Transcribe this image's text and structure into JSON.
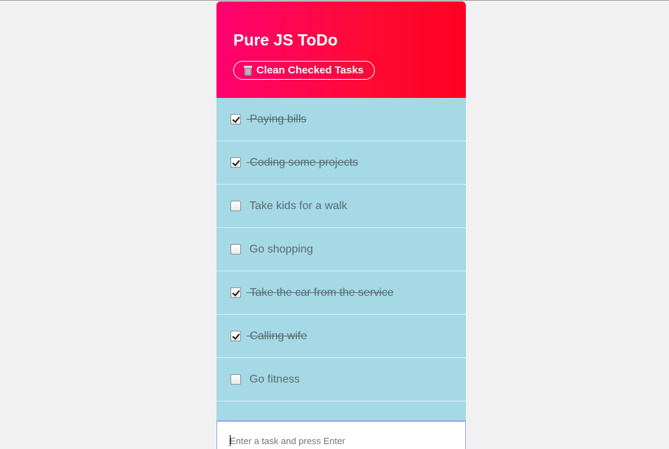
{
  "app": {
    "title": "Pure JS ToDo",
    "clean_button_label": "Clean Checked Tasks",
    "clean_button_icon": "trash-icon"
  },
  "tasks": [
    {
      "label": "Paying bills",
      "checked": true
    },
    {
      "label": "Coding some projects",
      "checked": true
    },
    {
      "label": "Take kids for a walk",
      "checked": false
    },
    {
      "label": "Go shopping",
      "checked": false
    },
    {
      "label": "Take the car from the service",
      "checked": true
    },
    {
      "label": "Calling wife",
      "checked": true
    },
    {
      "label": "Go fitness",
      "checked": false
    }
  ],
  "input": {
    "placeholder": "Enter a task and press Enter",
    "value": ""
  },
  "colors": {
    "header_gradient_start": "#ff0070",
    "header_gradient_end": "#ff0020",
    "list_background": "#a5d9e6",
    "page_background": "#f1f1f1",
    "input_focus_border": "#8fa6f0"
  }
}
